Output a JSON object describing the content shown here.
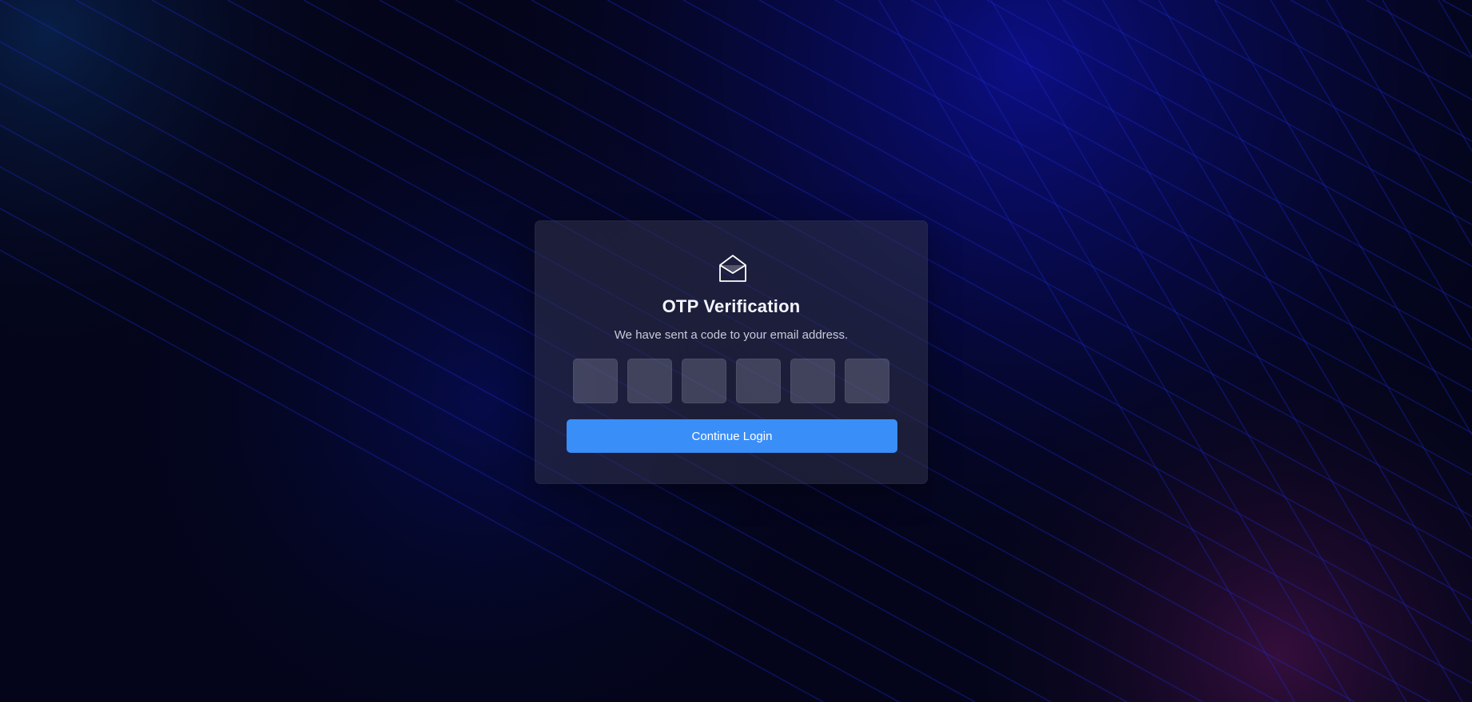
{
  "card": {
    "icon": "mail-open-icon",
    "title": "OTP Verification",
    "subtitle": "We have sent a code to your email address.",
    "otp_inputs": [
      {
        "value": ""
      },
      {
        "value": ""
      },
      {
        "value": ""
      },
      {
        "value": ""
      },
      {
        "value": ""
      },
      {
        "value": ""
      }
    ],
    "continue_label": "Continue Login"
  },
  "colors": {
    "background": "#05061a",
    "background_accent_blue": "#0a0f7a",
    "background_accent_purple": "#3a0f3e",
    "card": "#2a2c40",
    "otp_box": "#4a4c60",
    "button": "#3a8ef8",
    "title_text": "#f4f5fa",
    "subtitle_text": "#c9cbd8"
  }
}
